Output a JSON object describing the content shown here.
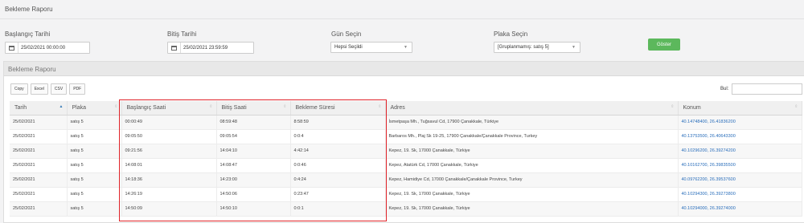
{
  "page": {
    "title": "Bekleme Raporu"
  },
  "filters": {
    "start": {
      "label": "Başlangıç Tarihi",
      "value": "25/02/2021 00:00:00"
    },
    "end": {
      "label": "Bitiş Tarihi",
      "value": "25/02/2021 23:59:59"
    },
    "day": {
      "label": "Gün Seçin",
      "value": "Hepsi Seçildi"
    },
    "plate": {
      "label": "Plaka Seçin",
      "value": "[Gruplanmamış: satış 5]"
    },
    "show_label": "Göster",
    "show_color": "#5cb85c"
  },
  "panel": {
    "title": "Bekleme Raporu",
    "buttons": [
      "Copy",
      "Excel",
      "CSV",
      "PDF"
    ],
    "search_label": "Bul:"
  },
  "table": {
    "columns": [
      "Tarih",
      "Plaka",
      "Başlangıç Saati",
      "Bitiş Saati",
      "Bekleme Süresi",
      "Adres",
      "Konum"
    ],
    "rows": [
      [
        "25/02/2021",
        "satış 5",
        "00:00:49",
        "08:59:48",
        "8:58:59",
        "İsmetpaşa Mh., Tuğsavul Cd, 17900 Çanakkale, Türkiye",
        "40.14748400, 26.41836200"
      ],
      [
        "25/02/2021",
        "satış 5",
        "09:05:50",
        "09:05:54",
        "0:0:4",
        "Barbaros Mh., Plaj Sk 19-25, 17900 Çanakkale/Çanakkale Province, Turkey",
        "40.13753500, 26.40643300"
      ],
      [
        "25/02/2021",
        "satış 5",
        "09:21:56",
        "14:04:10",
        "4:42:14",
        "Kepez, 19. Sk, 17000 Çanakkale, Türkiye",
        "40.10296200, 26.39274200"
      ],
      [
        "25/02/2021",
        "satış 5",
        "14:08:01",
        "14:08:47",
        "0:0:46",
        "Kepez, Atatürk Cd, 17000 Çanakkale, Türkiye",
        "40.10162700, 26.39835500"
      ],
      [
        "25/02/2021",
        "satış 5",
        "14:18:36",
        "14:23:00",
        "0:4:24",
        "Kepez, Hamidiye Cd, 17000 Çanakkale/Çanakkale Province, Turkey",
        "40.09762200, 26.39537600"
      ],
      [
        "25/02/2021",
        "satış 5",
        "14:26:19",
        "14:50:06",
        "0:23:47",
        "Kepez, 19. Sk, 17000 Çanakkale, Türkiye",
        "40.10294300, 26.39273800"
      ],
      [
        "25/02/2021",
        "satış 5",
        "14:50:09",
        "14:50:10",
        "0:0:1",
        "Kepez, 19. Sk, 17000 Çanakkale, Türkiye",
        "40.10294000, 26.39274000"
      ]
    ]
  },
  "colors": {
    "highlight": "#e0242a",
    "link": "#2a6ebb"
  }
}
